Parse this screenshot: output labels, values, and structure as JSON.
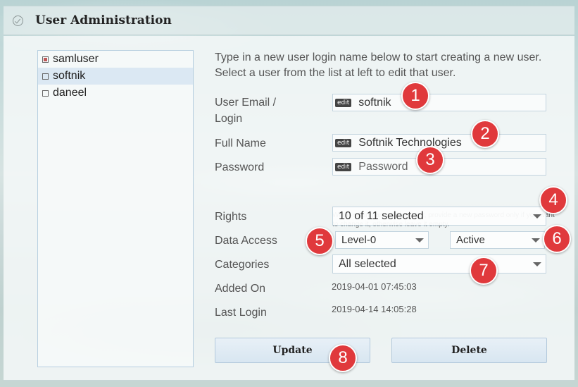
{
  "header": {
    "title": "User Administration",
    "icon": "check-circle-icon"
  },
  "users": [
    {
      "name": "samluser",
      "selected": false,
      "marked": true
    },
    {
      "name": "softnik",
      "selected": true,
      "marked": false
    },
    {
      "name": "daneel",
      "selected": false,
      "marked": false
    }
  ],
  "intro": "Type in a new user login name below to start creating a new user. Select a user from the list at left to edit that user.",
  "form": {
    "email_label_1": "User Email /",
    "email_label_2": "Login",
    "email_value": "softnik",
    "fullname_label": "Full Name",
    "fullname_value": "Softnik Technologies",
    "password_label": "Password",
    "password_placeholder": "Password",
    "password_hint": "When editing an existing user, provide a new password only if you want to change it, otherwise leave it empty.",
    "edit_tag": "edit",
    "rights_label": "Rights",
    "rights_value": "10 of 11 selected",
    "data_access_label": "Data Access",
    "data_access_level": "Level-0",
    "data_access_status": "Active",
    "categories_label": "Categories",
    "categories_value": "All selected",
    "added_on_label": "Added On",
    "added_on_value": "2019-04-01 07:45:03",
    "last_login_label": "Last Login",
    "last_login_value": "2019-04-14 14:05:28"
  },
  "buttons": {
    "update": "Update",
    "delete": "Delete"
  },
  "markers": [
    "1",
    "2",
    "3",
    "4",
    "5",
    "6",
    "7",
    "8"
  ],
  "colors": {
    "marker": "#e0393c",
    "selected_row": "#dbe8f3"
  }
}
